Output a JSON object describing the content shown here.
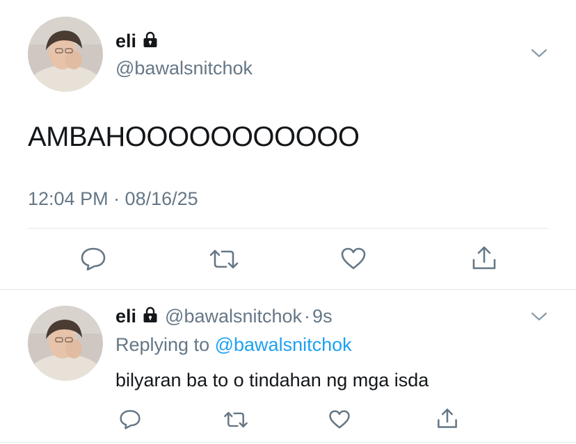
{
  "main_tweet": {
    "display_name": "eli",
    "handle": "@bawalsnitchok",
    "text": "AMBAHOOOOOOOOOOO",
    "timestamp": "12:04 PM · 08/16/25"
  },
  "reply_tweet": {
    "display_name": "eli",
    "handle": "@bawalsnitchok",
    "time_sep": "·",
    "time_ago": "9s",
    "replying_prefix": "Replying to",
    "replying_to": "@bawalsnitchok",
    "text": "bilyaran ba to o tindahan ng mga isda"
  },
  "icons": [
    "lock-icon",
    "chevron-down-icon",
    "reply-icon",
    "retweet-icon",
    "like-icon",
    "share-icon"
  ],
  "colors": {
    "text": "#14171a",
    "muted": "#657786",
    "link": "#1da1f2",
    "divider": "#e1e8ed"
  }
}
